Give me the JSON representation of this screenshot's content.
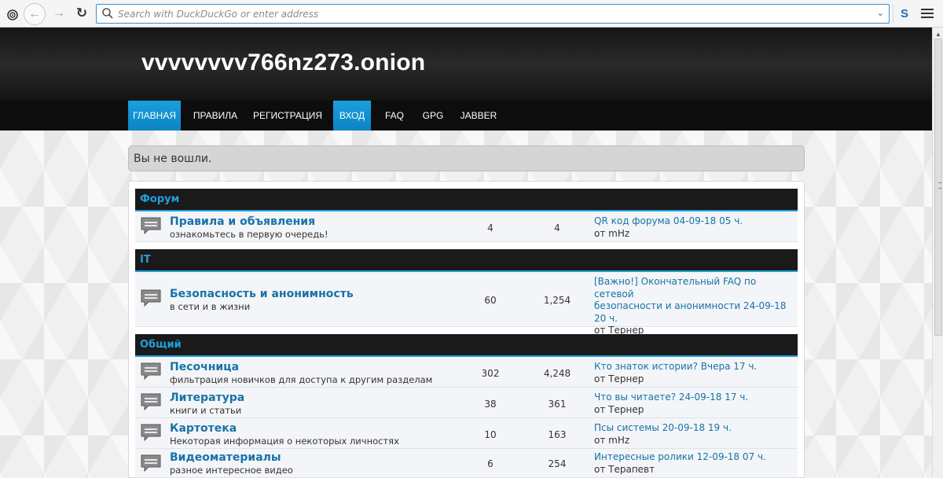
{
  "browser": {
    "address_placeholder": "Search with DuckDuckGo or enter address",
    "extension_label": "S"
  },
  "site": {
    "title": "vvvvvvvv766nz273.onion",
    "nav": [
      {
        "label": "ГЛАВНАЯ",
        "active": true
      },
      {
        "label": "ПРАВИЛА",
        "active": false
      },
      {
        "label": "РЕГИСТРАЦИЯ",
        "active": false
      },
      {
        "label": "ВХОД",
        "active": true
      },
      {
        "label": "FAQ",
        "active": false
      },
      {
        "label": "GPG",
        "active": false
      },
      {
        "label": "JABBER",
        "active": false
      }
    ],
    "notice": "Вы не вошли."
  },
  "categories": [
    {
      "name": "Форум",
      "forums": [
        {
          "title": "Правила и объявления",
          "desc": "ознакомьтесь в первую очередь!",
          "topics": "4",
          "posts": "4",
          "last_lines": [
            "QR код форума 04-09-18 05 ч."
          ],
          "last_by": "от mHz"
        }
      ]
    },
    {
      "name": "IT",
      "forums": [
        {
          "title": "Безопасность и анонимность",
          "desc": "в сети и в жизни",
          "topics": "60",
          "posts": "1,254",
          "last_lines": [
            "[Важно!] Окончательный FAQ по сетевой",
            "безопасности и анонимности 24-09-18",
            "20 ч."
          ],
          "last_by": "от Тернер"
        }
      ]
    },
    {
      "name": "Общий",
      "forums": [
        {
          "title": "Песочница",
          "desc": "фильтрация новичков для доступа к другим разделам",
          "topics": "302",
          "posts": "4,248",
          "last_lines": [
            "Кто знаток истории? Вчера 17 ч."
          ],
          "last_by": "от Тернер"
        },
        {
          "title": "Литература",
          "desc": "книги и статьи",
          "topics": "38",
          "posts": "361",
          "last_lines": [
            "Что вы читаете? 24-09-18 17 ч."
          ],
          "last_by": "от Тернер"
        },
        {
          "title": "Картотека",
          "desc": "Некоторая информация о некоторых личностях",
          "topics": "10",
          "posts": "163",
          "last_lines": [
            "Псы системы 20-09-18 19 ч."
          ],
          "last_by": "от mHz"
        },
        {
          "title": "Видеоматериалы",
          "desc": "разное интересное видео",
          "topics": "6",
          "posts": "254",
          "last_lines": [
            "Интересные ролики 12-09-18 07 ч."
          ],
          "last_by": "от Терапевт"
        }
      ]
    }
  ]
}
